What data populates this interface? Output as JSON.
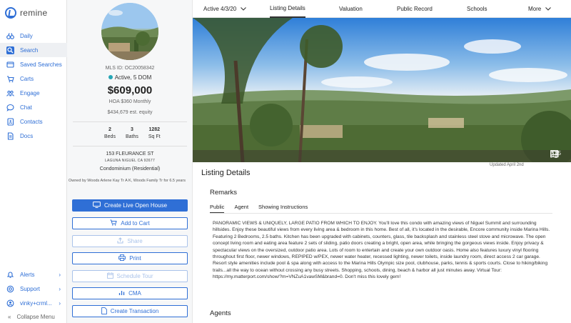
{
  "app": {
    "logo_text": "remine"
  },
  "sidebar": {
    "items": [
      {
        "label": "Daily",
        "icon": "binoculars-icon"
      },
      {
        "label": "Search",
        "icon": "search-icon"
      },
      {
        "label": "Saved Searches",
        "icon": "saved-searches-icon"
      },
      {
        "label": "Carts",
        "icon": "cart-icon"
      },
      {
        "label": "Engage",
        "icon": "engage-icon"
      },
      {
        "label": "Chat",
        "icon": "chat-icon"
      },
      {
        "label": "Contacts",
        "icon": "contacts-icon"
      },
      {
        "label": "Docs",
        "icon": "docs-icon"
      }
    ],
    "bottom_items": [
      {
        "label": "Alerts",
        "icon": "bell-icon"
      },
      {
        "label": "Support",
        "icon": "support-icon"
      },
      {
        "label": "vinky+crml...",
        "icon": "user-icon"
      }
    ],
    "collapse_label": "Collapse Menu"
  },
  "listing": {
    "mls_id": "MLS ID: OC20058342",
    "status": "Active, 5 DOM",
    "status_color": "#26a6b5",
    "price": "$609,000",
    "hoa": "HOA $360 Monthly",
    "equity": "$434,679 est. equity",
    "beds": {
      "value": "2",
      "label": "Beds"
    },
    "baths": {
      "value": "3",
      "label": "Baths"
    },
    "sqft": {
      "value": "1282",
      "label": "Sq Ft"
    },
    "address_line1": "153 FLEURANCE ST",
    "address_line2": "LAGUNA NIGUEL CA 92677",
    "property_type": "Condominium (Residential)",
    "owner": "Owned by Woods Arlene Kay Tr A K, Woods Family Tr for 6.5 years"
  },
  "actions": {
    "live_open_house": "Create Live Open House",
    "add_to_cart": "Add to Cart",
    "share": "Share",
    "print": "Print",
    "schedule_tour": "Schedule Tour",
    "cma": "CMA",
    "create_transaction": "Create Transaction"
  },
  "tabs": {
    "status_tab": "Active 4/3/20",
    "listing_details": "Listing Details",
    "valuation": "Valuation",
    "public_record": "Public Record",
    "schools": "Schools",
    "more": "More"
  },
  "hero": {
    "photo_count": "35",
    "updated": "Updated April 2nd"
  },
  "details": {
    "title": "Listing Details",
    "remarks_title": "Remarks",
    "subtabs": {
      "public": "Public",
      "agent": "Agent",
      "showing": "Showing Instructions"
    },
    "remarks_text": "PANORAMIC VIEWS & UNIQUELY, LARGE PATIO FROM WHICH TO ENJOY. You'll love this condo with amazing views of Niguel Summit and surrounding hillsides. Enjoy these beautiful views from every living area & bedroom in this home. Best of all, it's located in the desirable, Encore community inside Marina Hills. Featuring 2 Bedrooms, 2.5 baths. Kitchen has been upgraded with cabinets, counters, glass, tile backsplash and stainless steel stove and microwave. The open concept living room and eating area feature 2 sets of sliding, patio doors creating a bright, open area, while bringing the gorgeous views inside. Enjoy privacy & spectacular views on the oversized, outdoor patio area. Lots of room to entertain and create your own outdoor oasis. Home also features luxury vinyl flooring throughout first floor, newer windows, REPIPED w/PEX, newer water heater, recessed lighting, newer toilets, inside laundry room, direct access 2 car garage. Resort style amenities include pool & spa along with access to the Marina Hills Olympic size pool, clubhouse, parks, tennis & sports courts. Close to hiking/biking trails...all the way to ocean without crossing any busy streets. Shopping, schools, dining, beach & harbor all just minutes away. Virtual Tour: https://my.matterport.com/show/?m=VNZuA1vawSM&brand=0. Don't miss this lovely gem!",
    "agents_title": "Agents"
  },
  "colors": {
    "accent": "#2f6fd6"
  }
}
